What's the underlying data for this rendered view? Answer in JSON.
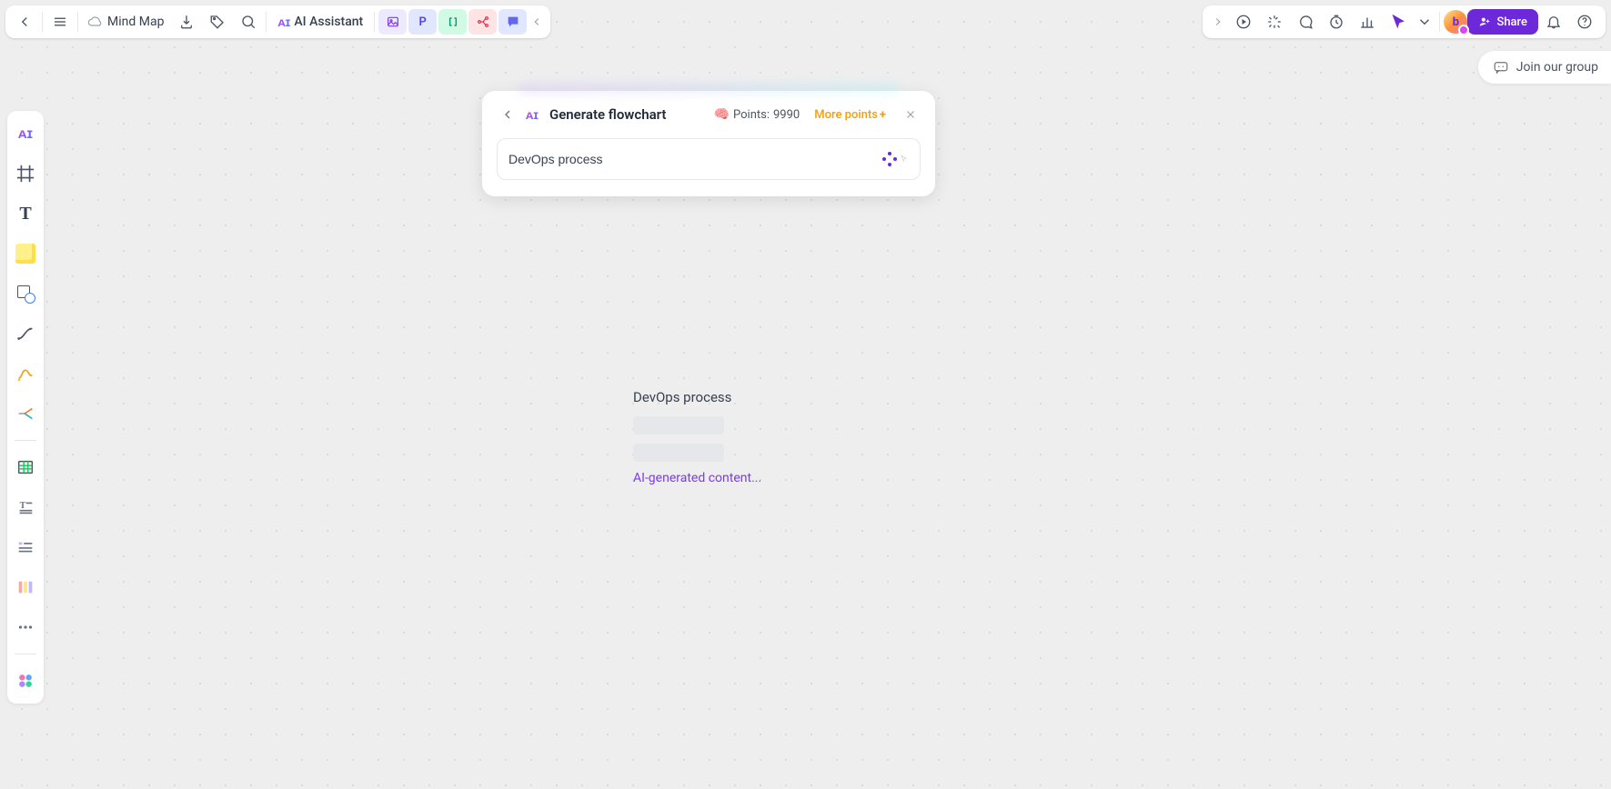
{
  "document": {
    "title": "Mind Map"
  },
  "top_left": {
    "ai_assistant_label": "AI Assistant"
  },
  "top_right": {
    "share_label": "Share"
  },
  "join_group": {
    "label": "Join our group"
  },
  "dialog": {
    "title": "Generate flowchart",
    "points_label": "Points:",
    "points_value": "9990",
    "more_points": "More points",
    "input_value": "DevOps process"
  },
  "canvas": {
    "placeholder_title": "DevOps process",
    "status_text": "AI-generated content..."
  }
}
